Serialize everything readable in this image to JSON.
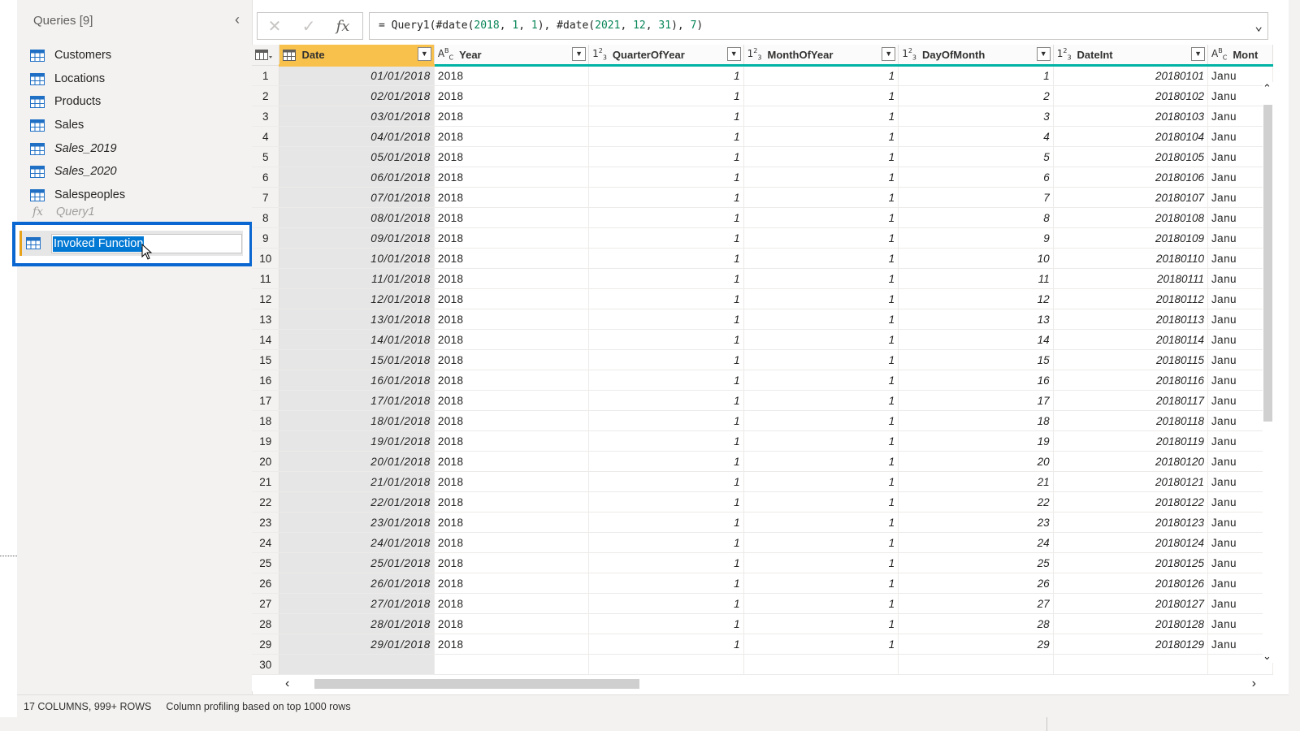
{
  "queries": {
    "title": "Queries [9]",
    "items": [
      {
        "label": "Customers",
        "italic": false
      },
      {
        "label": "Locations",
        "italic": false
      },
      {
        "label": "Products",
        "italic": false
      },
      {
        "label": "Sales",
        "italic": false
      },
      {
        "label": "Sales_2019",
        "italic": true
      },
      {
        "label": "Sales_2020",
        "italic": true
      },
      {
        "label": "Salespeoples",
        "italic": false
      },
      {
        "label": "Query1",
        "italic": true,
        "function": true
      }
    ],
    "editing_item": "Invoked Function"
  },
  "formula": {
    "prefix": "= Query1(#date(",
    "a1": "2018",
    "a2": "1",
    "a3": "1",
    "mid": "), #date(",
    "b1": "2021",
    "b2": "12",
    "b3": "31",
    "end": "), ",
    "c1": "7",
    "tail": ")"
  },
  "columns": [
    {
      "name": "Date",
      "type": "date"
    },
    {
      "name": "Year",
      "type": "text"
    },
    {
      "name": "QuarterOfYear",
      "type": "number"
    },
    {
      "name": "MonthOfYear",
      "type": "number"
    },
    {
      "name": "DayOfMonth",
      "type": "number"
    },
    {
      "name": "DateInt",
      "type": "number"
    },
    {
      "name": "Mont",
      "type": "text"
    }
  ],
  "rows": [
    [
      "01/01/2018",
      "2018",
      "1",
      "1",
      "1",
      "20180101",
      "Janu"
    ],
    [
      "02/01/2018",
      "2018",
      "1",
      "1",
      "2",
      "20180102",
      "Janu"
    ],
    [
      "03/01/2018",
      "2018",
      "1",
      "1",
      "3",
      "20180103",
      "Janu"
    ],
    [
      "04/01/2018",
      "2018",
      "1",
      "1",
      "4",
      "20180104",
      "Janu"
    ],
    [
      "05/01/2018",
      "2018",
      "1",
      "1",
      "5",
      "20180105",
      "Janu"
    ],
    [
      "06/01/2018",
      "2018",
      "1",
      "1",
      "6",
      "20180106",
      "Janu"
    ],
    [
      "07/01/2018",
      "2018",
      "1",
      "1",
      "7",
      "20180107",
      "Janu"
    ],
    [
      "08/01/2018",
      "2018",
      "1",
      "1",
      "8",
      "20180108",
      "Janu"
    ],
    [
      "09/01/2018",
      "2018",
      "1",
      "1",
      "9",
      "20180109",
      "Janu"
    ],
    [
      "10/01/2018",
      "2018",
      "1",
      "1",
      "10",
      "20180110",
      "Janu"
    ],
    [
      "11/01/2018",
      "2018",
      "1",
      "1",
      "11",
      "20180111",
      "Janu"
    ],
    [
      "12/01/2018",
      "2018",
      "1",
      "1",
      "12",
      "20180112",
      "Janu"
    ],
    [
      "13/01/2018",
      "2018",
      "1",
      "1",
      "13",
      "20180113",
      "Janu"
    ],
    [
      "14/01/2018",
      "2018",
      "1",
      "1",
      "14",
      "20180114",
      "Janu"
    ],
    [
      "15/01/2018",
      "2018",
      "1",
      "1",
      "15",
      "20180115",
      "Janu"
    ],
    [
      "16/01/2018",
      "2018",
      "1",
      "1",
      "16",
      "20180116",
      "Janu"
    ],
    [
      "17/01/2018",
      "2018",
      "1",
      "1",
      "17",
      "20180117",
      "Janu"
    ],
    [
      "18/01/2018",
      "2018",
      "1",
      "1",
      "18",
      "20180118",
      "Janu"
    ],
    [
      "19/01/2018",
      "2018",
      "1",
      "1",
      "19",
      "20180119",
      "Janu"
    ],
    [
      "20/01/2018",
      "2018",
      "1",
      "1",
      "20",
      "20180120",
      "Janu"
    ],
    [
      "21/01/2018",
      "2018",
      "1",
      "1",
      "21",
      "20180121",
      "Janu"
    ],
    [
      "22/01/2018",
      "2018",
      "1",
      "1",
      "22",
      "20180122",
      "Janu"
    ],
    [
      "23/01/2018",
      "2018",
      "1",
      "1",
      "23",
      "20180123",
      "Janu"
    ],
    [
      "24/01/2018",
      "2018",
      "1",
      "1",
      "24",
      "20180124",
      "Janu"
    ],
    [
      "25/01/2018",
      "2018",
      "1",
      "1",
      "25",
      "20180125",
      "Janu"
    ],
    [
      "26/01/2018",
      "2018",
      "1",
      "1",
      "26",
      "20180126",
      "Janu"
    ],
    [
      "27/01/2018",
      "2018",
      "1",
      "1",
      "27",
      "20180127",
      "Janu"
    ],
    [
      "28/01/2018",
      "2018",
      "1",
      "1",
      "28",
      "20180128",
      "Janu"
    ],
    [
      "29/01/2018",
      "2018",
      "1",
      "1",
      "29",
      "20180129",
      "Janu"
    ],
    [
      "",
      "",
      "",
      "",
      "",
      "",
      ""
    ]
  ],
  "row_numbers": [
    "1",
    "2",
    "3",
    "4",
    "5",
    "6",
    "7",
    "8",
    "9",
    "10",
    "11",
    "12",
    "13",
    "14",
    "15",
    "16",
    "17",
    "18",
    "19",
    "20",
    "21",
    "22",
    "23",
    "24",
    "25",
    "26",
    "27",
    "28",
    "29",
    "30"
  ],
  "status": {
    "summary": "17 COLUMNS, 999+ ROWS",
    "profiling": "Column profiling based on top 1000 rows"
  },
  "colors": {
    "accent_blue": "#0a67d1",
    "date_header": "#f8c14c",
    "header_underline": "#00b3a4",
    "table_icon": "#1f6fc5"
  }
}
